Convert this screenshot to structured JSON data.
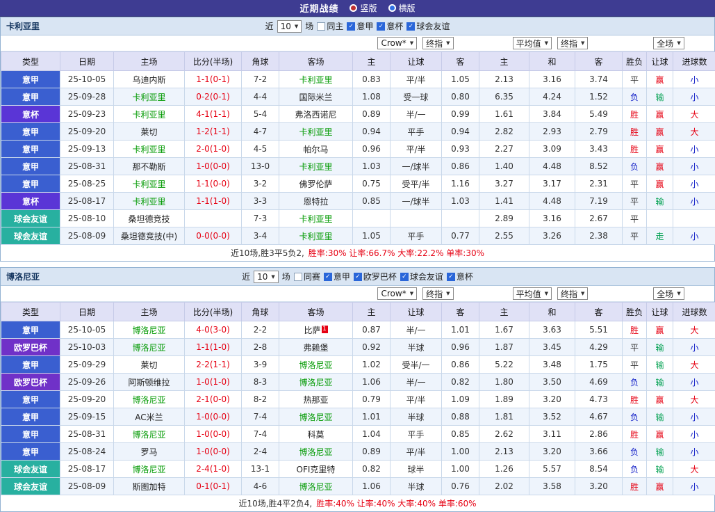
{
  "title_bar": {
    "title": "近期战绩",
    "radio_vertical": "竖版",
    "radio_horizontal": "横版"
  },
  "colors": {
    "topbar-bg": "#3e3c92",
    "header-bar-bg": "#d9e5f3",
    "table-head-bg": "#e0e1f6",
    "row-alt-bg": "#eef4fc",
    "grid": "#c9d8ea",
    "outer-border": "#93b2d2",
    "serie-a": "#3a5fd0",
    "coppa": "#5a35d6",
    "europa": "#7031c8",
    "friendly": "#28b0a0",
    "win-red": "#e60012",
    "lose-blue": "#1522c8",
    "lose-green": "#00a050",
    "focal-green": "#009900",
    "score-red": "#e60012"
  },
  "sections": [
    {
      "team": "卡利亚里",
      "recent_label": "近",
      "recent_value": "10",
      "games_label": "场",
      "same_label": "同主",
      "leagues": [
        {
          "label": "意甲"
        },
        {
          "label": "意杯"
        },
        {
          "label": "球会友谊"
        }
      ],
      "dropdowns": {
        "company": "Crow*",
        "company_time": "终指",
        "average": "平均值",
        "average_time": "终指",
        "scope": "全场"
      },
      "columns": [
        "类型",
        "日期",
        "主场",
        "比分(半场)",
        "角球",
        "客场",
        "主",
        "让球",
        "客",
        "主",
        "和",
        "客",
        "胜负",
        "让球",
        "进球数"
      ],
      "matches": [
        {
          "type": "意甲",
          "date": "25-10-05",
          "home": "乌迪内斯",
          "score": "1-1(0-1)",
          "corner": "7-2",
          "away": "卡利亚里",
          "odds_home": "0.83",
          "handicap": "平/半",
          "odds_away": "1.05",
          "avg_home": "2.13",
          "avg_draw": "3.16",
          "avg_away": "3.74",
          "result": "平",
          "handicap_result": "赢",
          "goals_result": "小"
        },
        {
          "type": "意甲",
          "date": "25-09-28",
          "home": "卡利亚里",
          "score": "0-2(0-1)",
          "corner": "4-4",
          "away": "国际米兰",
          "odds_home": "1.08",
          "handicap": "受一球",
          "odds_away": "0.80",
          "avg_home": "6.35",
          "avg_draw": "4.24",
          "avg_away": "1.52",
          "result": "负",
          "handicap_result": "输",
          "goals_result": "小"
        },
        {
          "type": "意杯",
          "date": "25-09-23",
          "home": "卡利亚里",
          "score": "4-1(1-1)",
          "corner": "5-4",
          "away": "弗洛西诺尼",
          "odds_home": "0.89",
          "handicap": "半/一",
          "odds_away": "0.99",
          "avg_home": "1.61",
          "avg_draw": "3.84",
          "avg_away": "5.49",
          "result": "胜",
          "handicap_result": "赢",
          "goals_result": "大"
        },
        {
          "type": "意甲",
          "date": "25-09-20",
          "home": "莱切",
          "score": "1-2(1-1)",
          "corner": "4-7",
          "away": "卡利亚里",
          "odds_home": "0.94",
          "handicap": "平手",
          "odds_away": "0.94",
          "avg_home": "2.82",
          "avg_draw": "2.93",
          "avg_away": "2.79",
          "result": "胜",
          "handicap_result": "赢",
          "goals_result": "大"
        },
        {
          "type": "意甲",
          "date": "25-09-13",
          "home": "卡利亚里",
          "score": "2-0(1-0)",
          "corner": "4-5",
          "away": "帕尔马",
          "odds_home": "0.96",
          "handicap": "平/半",
          "odds_away": "0.93",
          "avg_home": "2.27",
          "avg_draw": "3.09",
          "avg_away": "3.43",
          "result": "胜",
          "handicap_result": "赢",
          "goals_result": "小"
        },
        {
          "type": "意甲",
          "date": "25-08-31",
          "home": "那不勒斯",
          "score": "1-0(0-0)",
          "corner": "13-0",
          "away": "卡利亚里",
          "odds_home": "1.03",
          "handicap": "一/球半",
          "odds_away": "0.86",
          "avg_home": "1.40",
          "avg_draw": "4.48",
          "avg_away": "8.52",
          "result": "负",
          "handicap_result": "赢",
          "goals_result": "小"
        },
        {
          "type": "意甲",
          "date": "25-08-25",
          "home": "卡利亚里",
          "score": "1-1(0-0)",
          "corner": "3-2",
          "away": "佛罗伦萨",
          "odds_home": "0.75",
          "handicap": "受平/半",
          "odds_away": "1.16",
          "avg_home": "3.27",
          "avg_draw": "3.17",
          "avg_away": "2.31",
          "result": "平",
          "handicap_result": "赢",
          "goals_result": "小"
        },
        {
          "type": "意杯",
          "date": "25-08-17",
          "home": "卡利亚里",
          "score": "1-1(1-0)",
          "corner": "3-3",
          "away": "恩特拉",
          "odds_home": "0.85",
          "handicap": "一/球半",
          "odds_away": "1.03",
          "avg_home": "1.41",
          "avg_draw": "4.48",
          "avg_away": "7.19",
          "result": "平",
          "handicap_result": "输",
          "goals_result": "小"
        },
        {
          "type": "球会友谊",
          "date": "25-08-10",
          "home": "桑坦德竞技",
          "score": "",
          "corner": "7-3",
          "away": "卡利亚里",
          "odds_home": "",
          "handicap": "",
          "odds_away": "",
          "avg_home": "2.89",
          "avg_draw": "3.16",
          "avg_away": "2.67",
          "result": "平",
          "handicap_result": "",
          "goals_result": ""
        },
        {
          "type": "球会友谊",
          "date": "25-08-09",
          "home": "桑坦德竞技(中)",
          "score": "0-0(0-0)",
          "corner": "3-4",
          "away": "卡利亚里",
          "odds_home": "1.05",
          "handicap": "平手",
          "odds_away": "0.77",
          "avg_home": "2.55",
          "avg_draw": "3.26",
          "avg_away": "2.38",
          "result": "平",
          "handicap_result": "走",
          "goals_result": "小"
        }
      ],
      "summary_prefix": "近10场,胜3平5负2,",
      "summary_stats": "胜率:30% 让率:66.7% 大率:22.2% 单率:30%"
    },
    {
      "team": "博洛尼亚",
      "recent_label": "近",
      "recent_value": "10",
      "games_label": "场",
      "same_label": "同赛",
      "leagues": [
        {
          "label": "意甲"
        },
        {
          "label": "欧罗巴杯"
        },
        {
          "label": "球会友谊"
        },
        {
          "label": "意杯"
        }
      ],
      "dropdowns": {
        "company": "Crow*",
        "company_time": "终指",
        "average": "平均值",
        "average_time": "终指",
        "scope": "全场"
      },
      "columns": [
        "类型",
        "日期",
        "主场",
        "比分(半场)",
        "角球",
        "客场",
        "主",
        "让球",
        "客",
        "主",
        "和",
        "客",
        "胜负",
        "让球",
        "进球数"
      ],
      "matches": [
        {
          "type": "意甲",
          "date": "25-10-05",
          "home": "博洛尼亚",
          "score": "4-0(3-0)",
          "corner": "2-2",
          "away": "比萨",
          "away_badge": "1",
          "odds_home": "0.87",
          "handicap": "半/一",
          "odds_away": "1.01",
          "avg_home": "1.67",
          "avg_draw": "3.63",
          "avg_away": "5.51",
          "result": "胜",
          "handicap_result": "赢",
          "goals_result": "大"
        },
        {
          "type": "欧罗巴杯",
          "date": "25-10-03",
          "home": "博洛尼亚",
          "score": "1-1(1-0)",
          "corner": "2-8",
          "away": "弗赖堡",
          "odds_home": "0.92",
          "handicap": "半球",
          "odds_away": "0.96",
          "avg_home": "1.87",
          "avg_draw": "3.45",
          "avg_away": "4.29",
          "result": "平",
          "handicap_result": "输",
          "goals_result": "小"
        },
        {
          "type": "意甲",
          "date": "25-09-29",
          "home": "莱切",
          "score": "2-2(1-1)",
          "corner": "3-9",
          "away": "博洛尼亚",
          "odds_home": "1.02",
          "handicap": "受半/一",
          "odds_away": "0.86",
          "avg_home": "5.22",
          "avg_draw": "3.48",
          "avg_away": "1.75",
          "result": "平",
          "handicap_result": "输",
          "goals_result": "大"
        },
        {
          "type": "欧罗巴杯",
          "date": "25-09-26",
          "home": "阿斯顿维拉",
          "score": "1-0(1-0)",
          "corner": "8-3",
          "away": "博洛尼亚",
          "odds_home": "1.06",
          "handicap": "半/一",
          "odds_away": "0.82",
          "avg_home": "1.80",
          "avg_draw": "3.50",
          "avg_away": "4.69",
          "result": "负",
          "handicap_result": "输",
          "goals_result": "小"
        },
        {
          "type": "意甲",
          "date": "25-09-20",
          "home": "博洛尼亚",
          "score": "2-1(0-0)",
          "corner": "8-2",
          "away": "热那亚",
          "odds_home": "0.79",
          "handicap": "平/半",
          "odds_away": "1.09",
          "avg_home": "1.89",
          "avg_draw": "3.20",
          "avg_away": "4.73",
          "result": "胜",
          "handicap_result": "赢",
          "goals_result": "大"
        },
        {
          "type": "意甲",
          "date": "25-09-15",
          "home": "AC米兰",
          "score": "1-0(0-0)",
          "corner": "7-4",
          "away": "博洛尼亚",
          "odds_home": "1.01",
          "handicap": "半球",
          "odds_away": "0.88",
          "avg_home": "1.81",
          "avg_draw": "3.52",
          "avg_away": "4.67",
          "result": "负",
          "handicap_result": "输",
          "goals_result": "小"
        },
        {
          "type": "意甲",
          "date": "25-08-31",
          "home": "博洛尼亚",
          "score": "1-0(0-0)",
          "corner": "7-4",
          "away": "科莫",
          "odds_home": "1.04",
          "handicap": "平手",
          "odds_away": "0.85",
          "avg_home": "2.62",
          "avg_draw": "3.11",
          "avg_away": "2.86",
          "result": "胜",
          "handicap_result": "赢",
          "goals_result": "小"
        },
        {
          "type": "意甲",
          "date": "25-08-24",
          "home": "罗马",
          "score": "1-0(0-0)",
          "corner": "2-4",
          "away": "博洛尼亚",
          "odds_home": "0.89",
          "handicap": "平/半",
          "odds_away": "1.00",
          "avg_home": "2.13",
          "avg_draw": "3.20",
          "avg_away": "3.66",
          "result": "负",
          "handicap_result": "输",
          "goals_result": "小"
        },
        {
          "type": "球会友谊",
          "date": "25-08-17",
          "home": "博洛尼亚",
          "score": "2-4(1-0)",
          "corner": "13-1",
          "away": "OFI克里特",
          "odds_home": "0.82",
          "handicap": "球半",
          "odds_away": "1.00",
          "avg_home": "1.26",
          "avg_draw": "5.57",
          "avg_away": "8.54",
          "result": "负",
          "handicap_result": "输",
          "goals_result": "大"
        },
        {
          "type": "球会友谊",
          "date": "25-08-09",
          "home": "斯图加特",
          "score": "0-1(0-1)",
          "corner": "4-6",
          "away": "博洛尼亚",
          "odds_home": "1.06",
          "handicap": "半球",
          "odds_away": "0.76",
          "avg_home": "2.02",
          "avg_draw": "3.58",
          "avg_away": "3.20",
          "result": "胜",
          "handicap_result": "赢",
          "goals_result": "小"
        }
      ],
      "summary_prefix": "近10场,胜4平2负4,",
      "summary_stats": "胜率:40% 让率:40% 大率:40% 单率:60%"
    }
  ]
}
